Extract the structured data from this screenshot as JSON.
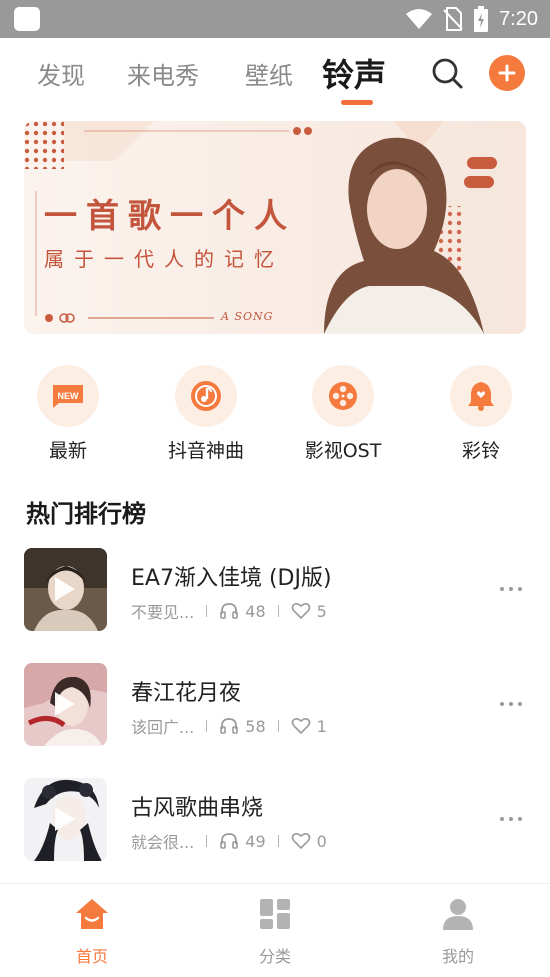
{
  "status_bar": {
    "time": "7:20"
  },
  "top_tabs": [
    {
      "label": "发现",
      "active": false
    },
    {
      "label": "来电秀",
      "active": false
    },
    {
      "label": "壁纸",
      "active": false
    },
    {
      "label": "铃声",
      "active": true
    }
  ],
  "banner": {
    "title": "一首歌一个人",
    "subtitle": "属于一代人的记忆",
    "tag": "A SONG"
  },
  "categories": [
    {
      "label": "最新",
      "icon": "new-icon",
      "badge": "NEW"
    },
    {
      "label": "抖音神曲",
      "icon": "music-note-icon"
    },
    {
      "label": "影视OST",
      "icon": "film-reel-icon"
    },
    {
      "label": "彩铃",
      "icon": "bell-icon"
    }
  ],
  "section_title": "热门排行榜",
  "songs": [
    {
      "title": "EA7渐入佳境 (DJ版)",
      "artist": "不要见...",
      "listens": "48",
      "likes": "5"
    },
    {
      "title": "春江花月夜",
      "artist": "该回广...",
      "listens": "58",
      "likes": "1"
    },
    {
      "title": "古风歌曲串烧",
      "artist": "就会很...",
      "listens": "49",
      "likes": "0"
    }
  ],
  "bottom_nav": [
    {
      "label": "首页",
      "icon": "home-icon",
      "active": true
    },
    {
      "label": "分类",
      "icon": "grid-icon",
      "active": false
    },
    {
      "label": "我的",
      "icon": "user-icon",
      "active": false
    }
  ],
  "colors": {
    "accent": "#f47a3d",
    "banner_text": "#c4553d",
    "status_bar": "#999999"
  }
}
